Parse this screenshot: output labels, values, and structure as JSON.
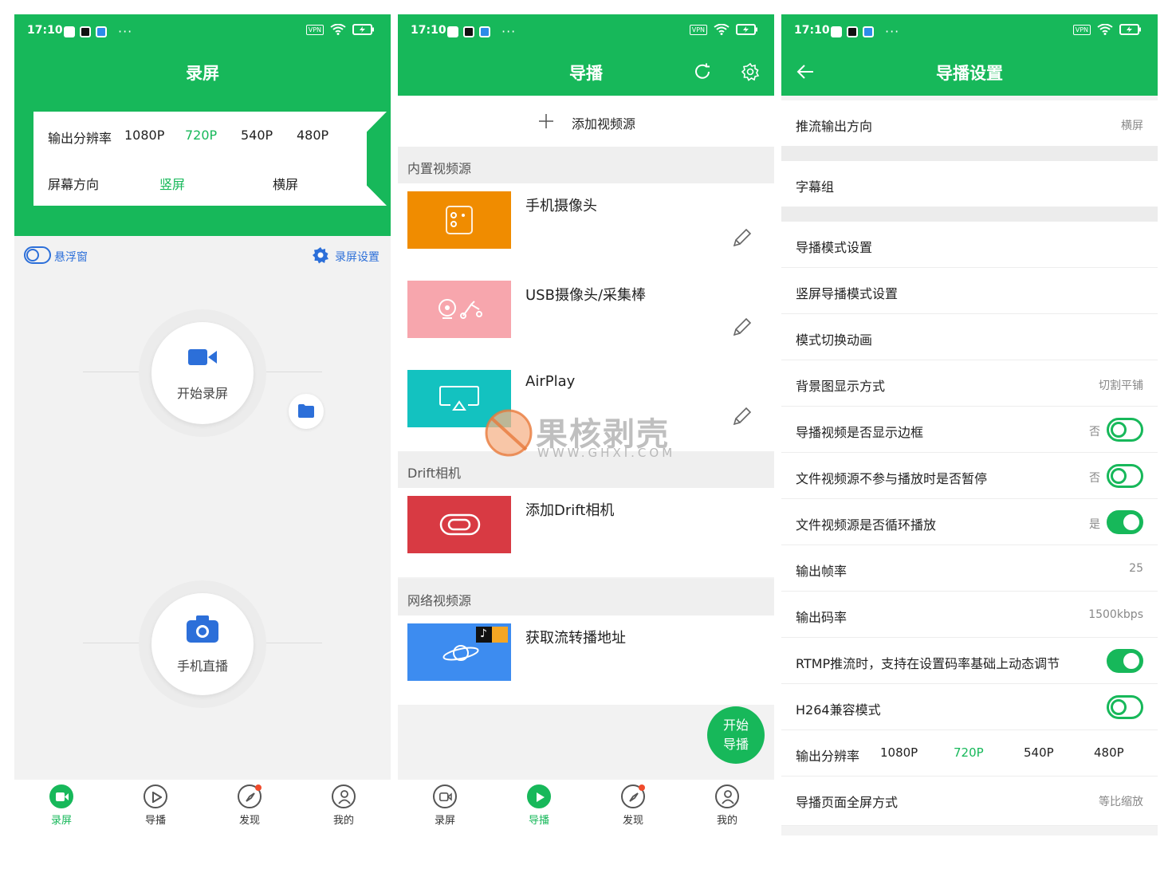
{
  "status": {
    "time": "17:10",
    "vpn": "VPN"
  },
  "p1": {
    "title": "录屏",
    "res_label": "输出分辨率",
    "res_options": [
      "1080P",
      "720P",
      "540P",
      "480P"
    ],
    "res_selected": "720P",
    "dir_label": "屏幕方向",
    "dir_options": [
      "竖屏",
      "横屏"
    ],
    "dir_selected": "竖屏",
    "float_label": "悬浮窗",
    "settings_label": "录屏设置",
    "start_record": "开始录屏",
    "phone_live": "手机直播"
  },
  "nav": [
    {
      "label": "录屏",
      "icon": "record-icon"
    },
    {
      "label": "导播",
      "icon": "play-icon"
    },
    {
      "label": "发现",
      "icon": "compass-icon"
    },
    {
      "label": "我的",
      "icon": "profile-icon"
    }
  ],
  "p2": {
    "title": "导播",
    "add_source": "添加视频源",
    "sect_builtin": "内置视频源",
    "sources_builtin": [
      {
        "name": "手机摄像头",
        "color": "#f08c00"
      },
      {
        "name": "USB摄像头/采集棒",
        "color": "#f7a6ad"
      },
      {
        "name": "AirPlay",
        "color": "#13c2c0"
      }
    ],
    "sect_drift": "Drift相机",
    "drift_source": {
      "name": "添加Drift相机",
      "color": "#d83a43"
    },
    "sect_network": "网络视频源",
    "network_source": {
      "name": "获取流转播地址",
      "color": "#3d8cf0"
    },
    "fab_line1": "开始",
    "fab_line2": "导播"
  },
  "p3": {
    "title": "导播设置",
    "rows": {
      "push_dir": {
        "label": "推流输出方向",
        "value": "横屏"
      },
      "subtitle": {
        "label": "字幕组"
      },
      "mode": {
        "label": "导播模式设置"
      },
      "vmode": {
        "label": "竖屏导播模式设置"
      },
      "anim": {
        "label": "模式切换动画"
      },
      "bg": {
        "label": "背景图显示方式",
        "value": "切割平铺"
      },
      "border": {
        "label": "导播视频是否显示边框",
        "value": "否"
      },
      "pause": {
        "label": "文件视频源不参与播放时是否暂停",
        "value": "否"
      },
      "loop": {
        "label": "文件视频源是否循环播放",
        "value": "是"
      },
      "fps": {
        "label": "输出帧率",
        "value": "25"
      },
      "bitrate": {
        "label": "输出码率",
        "value": "1500kbps"
      },
      "rtmp": {
        "label": "RTMP推流时，支持在设置码率基础上动态调节"
      },
      "h264": {
        "label": "H264兼容模式"
      },
      "res": {
        "label": "输出分辨率",
        "options": [
          "1080P",
          "720P",
          "540P",
          "480P"
        ],
        "selected": "720P"
      },
      "fullscreen": {
        "label": "导播页面全屏方式",
        "value": "等比缩放"
      }
    }
  },
  "watermark": {
    "main": "果核剥壳",
    "sub": "WWW.GHXI.COM"
  },
  "colors": {
    "brand": "#17b85a",
    "link": "#2c6fd9"
  }
}
